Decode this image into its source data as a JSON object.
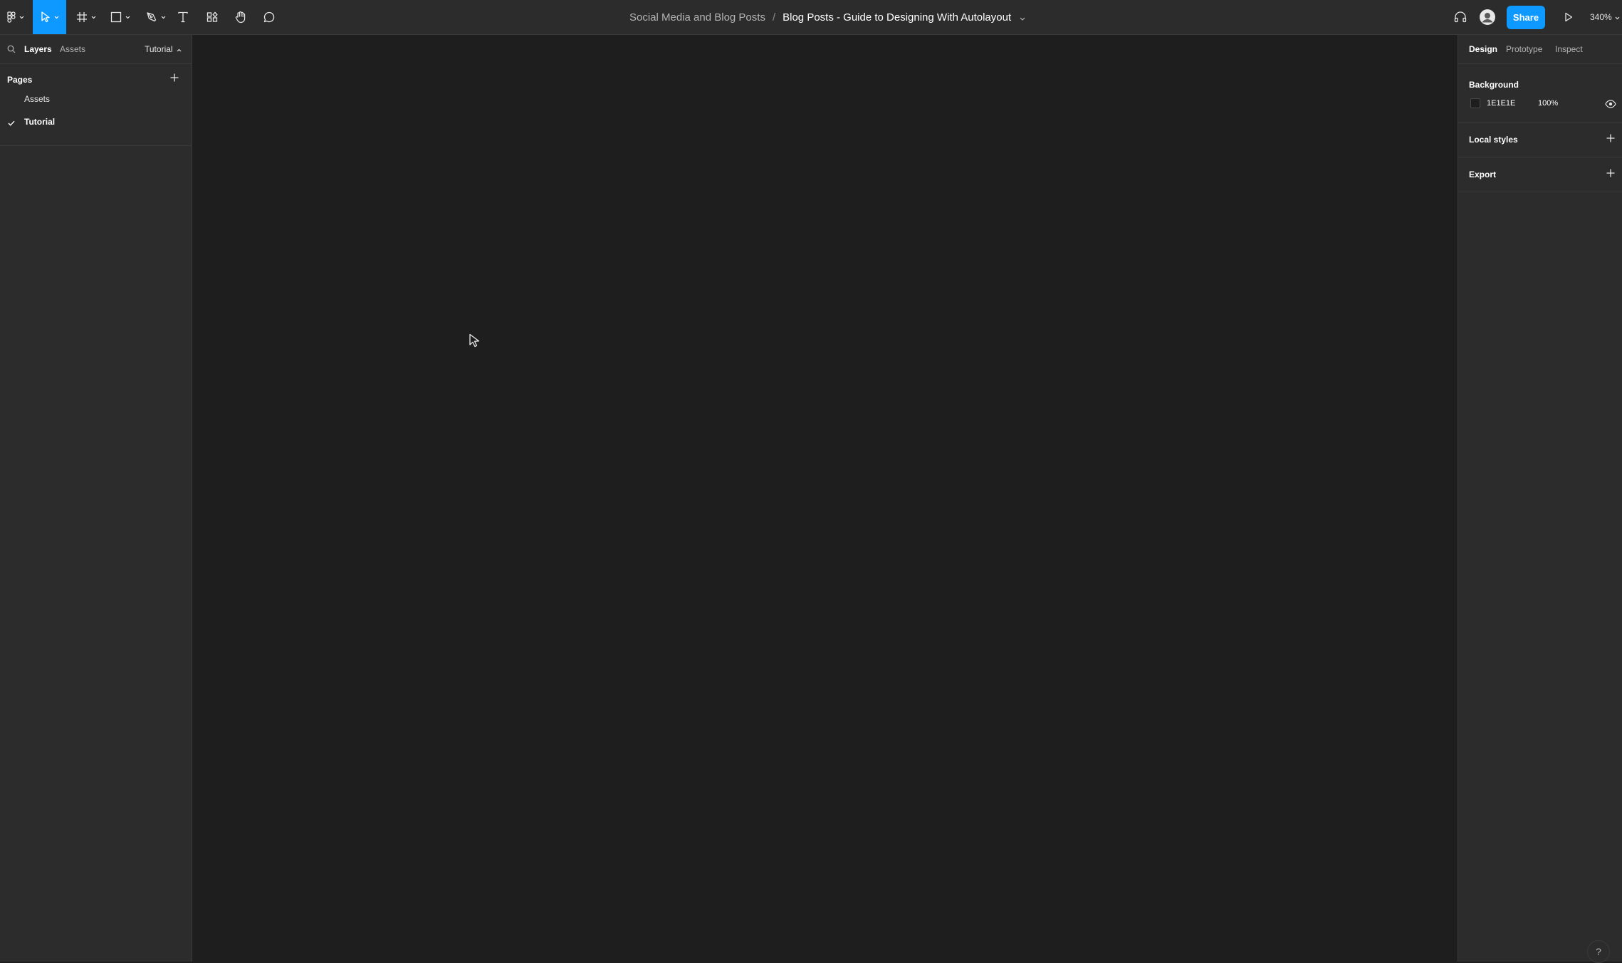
{
  "toolbar": {
    "tools": [
      {
        "name": "main-menu",
        "icon": "figma-logo-icon",
        "has_caret": true
      },
      {
        "name": "move",
        "icon": "cursor-icon",
        "has_caret": true,
        "active": true
      },
      {
        "name": "frame",
        "icon": "frame-icon",
        "has_caret": true
      },
      {
        "name": "shape",
        "icon": "rectangle-icon",
        "has_caret": true
      },
      {
        "name": "pen",
        "icon": "pen-icon",
        "has_caret": true
      },
      {
        "name": "text",
        "icon": "text-icon",
        "has_caret": false
      },
      {
        "name": "resources",
        "icon": "resources-icon",
        "has_caret": false
      },
      {
        "name": "hand",
        "icon": "hand-icon",
        "has_caret": false
      },
      {
        "name": "comment",
        "icon": "comment-icon",
        "has_caret": false
      }
    ],
    "accent_color": "#0d99ff"
  },
  "title": {
    "project": "Social Media and Blog Posts",
    "separator": "/",
    "file": "Blog Posts - Guide to Designing With Autolayout"
  },
  "header_right": {
    "audio_icon": "headphones-icon",
    "avatar_icon": "user-avatar",
    "share_label": "Share",
    "present_icon": "play-icon",
    "zoom": "340%"
  },
  "left_panel": {
    "tabs": [
      "Layers",
      "Assets"
    ],
    "active_tab": "Layers",
    "page_switcher": "Tutorial",
    "pages_header": "Pages",
    "pages": [
      {
        "label": "Assets",
        "current": false
      },
      {
        "label": "Tutorial",
        "current": true
      }
    ]
  },
  "right_panel": {
    "tabs": [
      "Design",
      "Prototype",
      "Inspect"
    ],
    "active_tab": "Design",
    "background": {
      "title": "Background",
      "hex": "1E1E1E",
      "opacity": "100%",
      "swatch_color": "#1e1e1e"
    },
    "local_styles_title": "Local styles",
    "export_title": "Export"
  },
  "help_label": "?"
}
